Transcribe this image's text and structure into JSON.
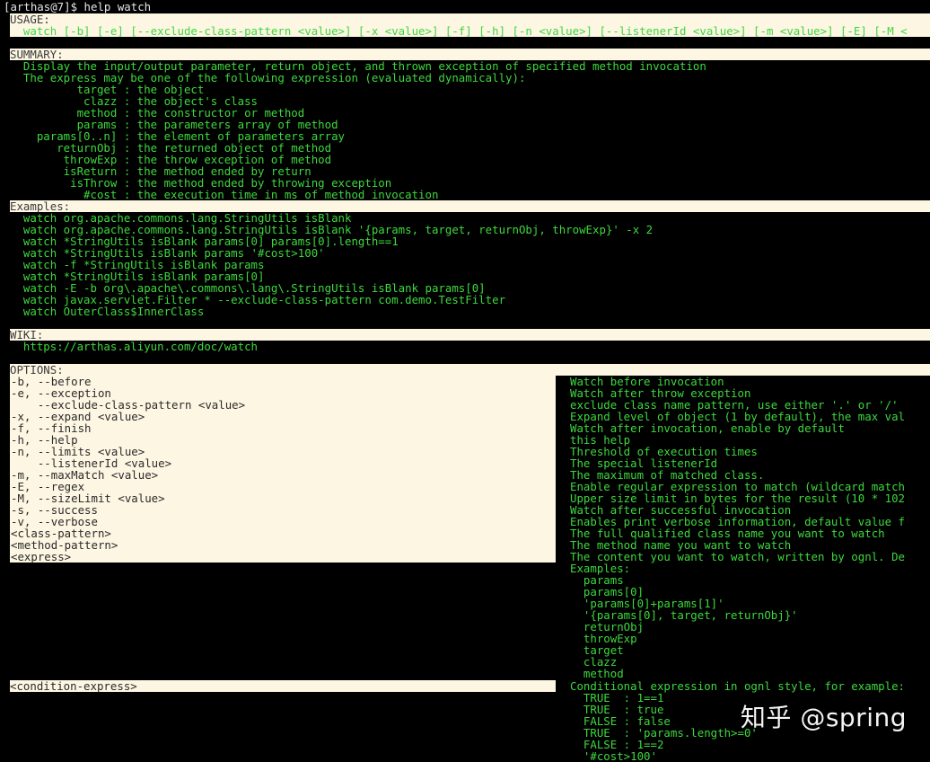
{
  "prompt": {
    "user_host": "[arthas@7]$",
    "command": "help watch"
  },
  "usage": {
    "header": "USAGE:",
    "line": "  watch [-b] [-e] [--exclude-class-pattern <value>] [-x <value>] [-f] [-h] [-n <value>] [--listenerId <value>] [-m <value>] [-E] [-M <"
  },
  "summary": {
    "header": "SUMMARY:",
    "lines": [
      "  Display the input/output parameter, return object, and thrown exception of specified method invocation",
      "  The express may be one of the following expression (evaluated dynamically):",
      "          target : the object",
      "           clazz : the object's class",
      "          method : the constructor or method",
      "          params : the parameters array of method",
      "    params[0..n] : the element of parameters array",
      "       returnObj : the returned object of method",
      "        throwExp : the throw exception of method",
      "        isReturn : the method ended by return",
      "         isThrow : the method ended by throwing exception",
      "           #cost : the execution time in ms of method invocation"
    ]
  },
  "examples": {
    "header": "Examples:",
    "lines": [
      "  watch org.apache.commons.lang.StringUtils isBlank",
      "  watch org.apache.commons.lang.StringUtils isBlank '{params, target, returnObj, throwExp}' -x 2",
      "  watch *StringUtils isBlank params[0] params[0].length==1",
      "  watch *StringUtils isBlank params '#cost>100'",
      "  watch -f *StringUtils isBlank params",
      "  watch *StringUtils isBlank params[0]",
      "  watch -E -b org\\.apache\\.commons\\.lang\\.StringUtils isBlank params[0]",
      "  watch javax.servlet.Filter * --exclude-class-pattern com.demo.TestFilter",
      "  watch OuterClass$InnerClass"
    ]
  },
  "wiki": {
    "header": "WIKI:",
    "url": "  https://arthas.aliyun.com/doc/watch"
  },
  "options": {
    "header": "OPTIONS:",
    "left": [
      "-b, --before",
      "-e, --exception",
      "    --exclude-class-pattern <value>",
      "-x, --expand <value>",
      "-f, --finish",
      "-h, --help",
      "-n, --limits <value>",
      "    --listenerId <value>",
      "-m, --maxMatch <value>",
      "-E, --regex",
      "-M, --sizeLimit <value>",
      "-s, --success",
      "-v, --verbose",
      "<class-pattern>",
      "<method-pattern>",
      "<express>"
    ],
    "right": [
      "Watch before invocation",
      "Watch after throw exception",
      "exclude class name pattern, use either '.' or '/'",
      "Expand level of object (1 by default), the max val",
      "Watch after invocation, enable by default",
      "this help",
      "Threshold of execution times",
      "The special listenerId",
      "The maximum of matched class.",
      "Enable regular expression to match (wildcard match",
      "Upper size limit in bytes for the result (10 * 102",
      "Watch after successful invocation",
      "Enables print verbose information, default value f",
      "The full qualified class name you want to watch",
      "The method name you want to watch",
      "The content you want to watch, written by ognl. De",
      "Examples:",
      "  params",
      "  params[0]",
      "  'params[0]+params[1]'",
      "  '{params[0], target, returnObj}'",
      "  returnObj",
      "  throwExp",
      "  target",
      "  clazz",
      "  method"
    ],
    "condition_left": "<condition-express>",
    "condition_right": [
      "Conditional expression in ognl style, for example:",
      "  TRUE  : 1==1",
      "  TRUE  : true",
      "  FALSE : false",
      "  TRUE  : 'params.length>=0'",
      "  FALSE : 1==2",
      "  '#cost>100'"
    ]
  },
  "watermark": "知乎 @spring"
}
